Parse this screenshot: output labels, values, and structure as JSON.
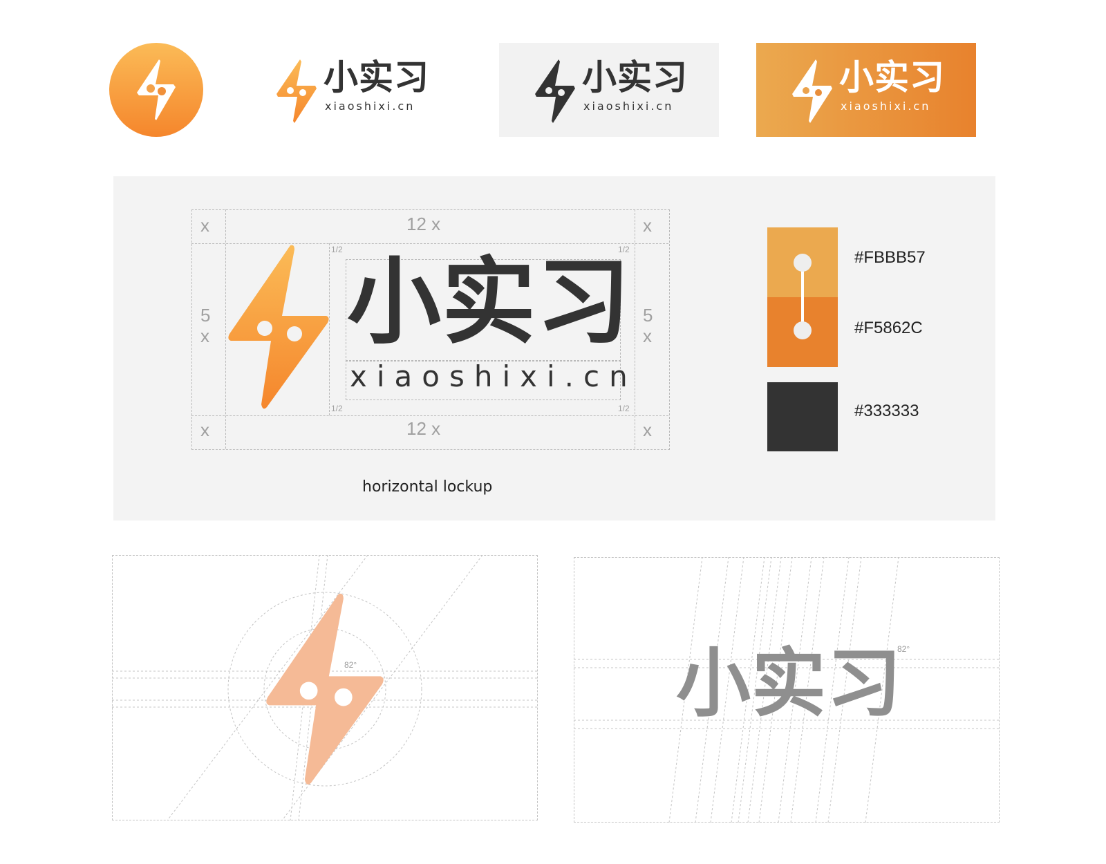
{
  "brand": {
    "wordmark": "小实习",
    "domain": "xiaoshixi.cn"
  },
  "spec": {
    "unit": "x",
    "width_label": "12 x",
    "height_label_num": "5",
    "height_label_unit": "x",
    "half_label": "1/2",
    "caption": "horizontal lockup"
  },
  "palette": {
    "swatches": [
      {
        "hex_label": "#FBBB57",
        "color": "#FBBB57"
      },
      {
        "hex_label": "#F5862C",
        "color": "#F5862C"
      },
      {
        "hex_label": "#333333",
        "color": "#333333"
      }
    ]
  },
  "construction": {
    "icon_angle": "82°",
    "wordmark_angle": "82°"
  },
  "colors": {
    "orange_light": "#FBBB57",
    "orange_dark": "#F5862C",
    "text_dark": "#333333",
    "construction_fill": "#F5BA96",
    "construction_text_fill": "#8f8f8f"
  }
}
